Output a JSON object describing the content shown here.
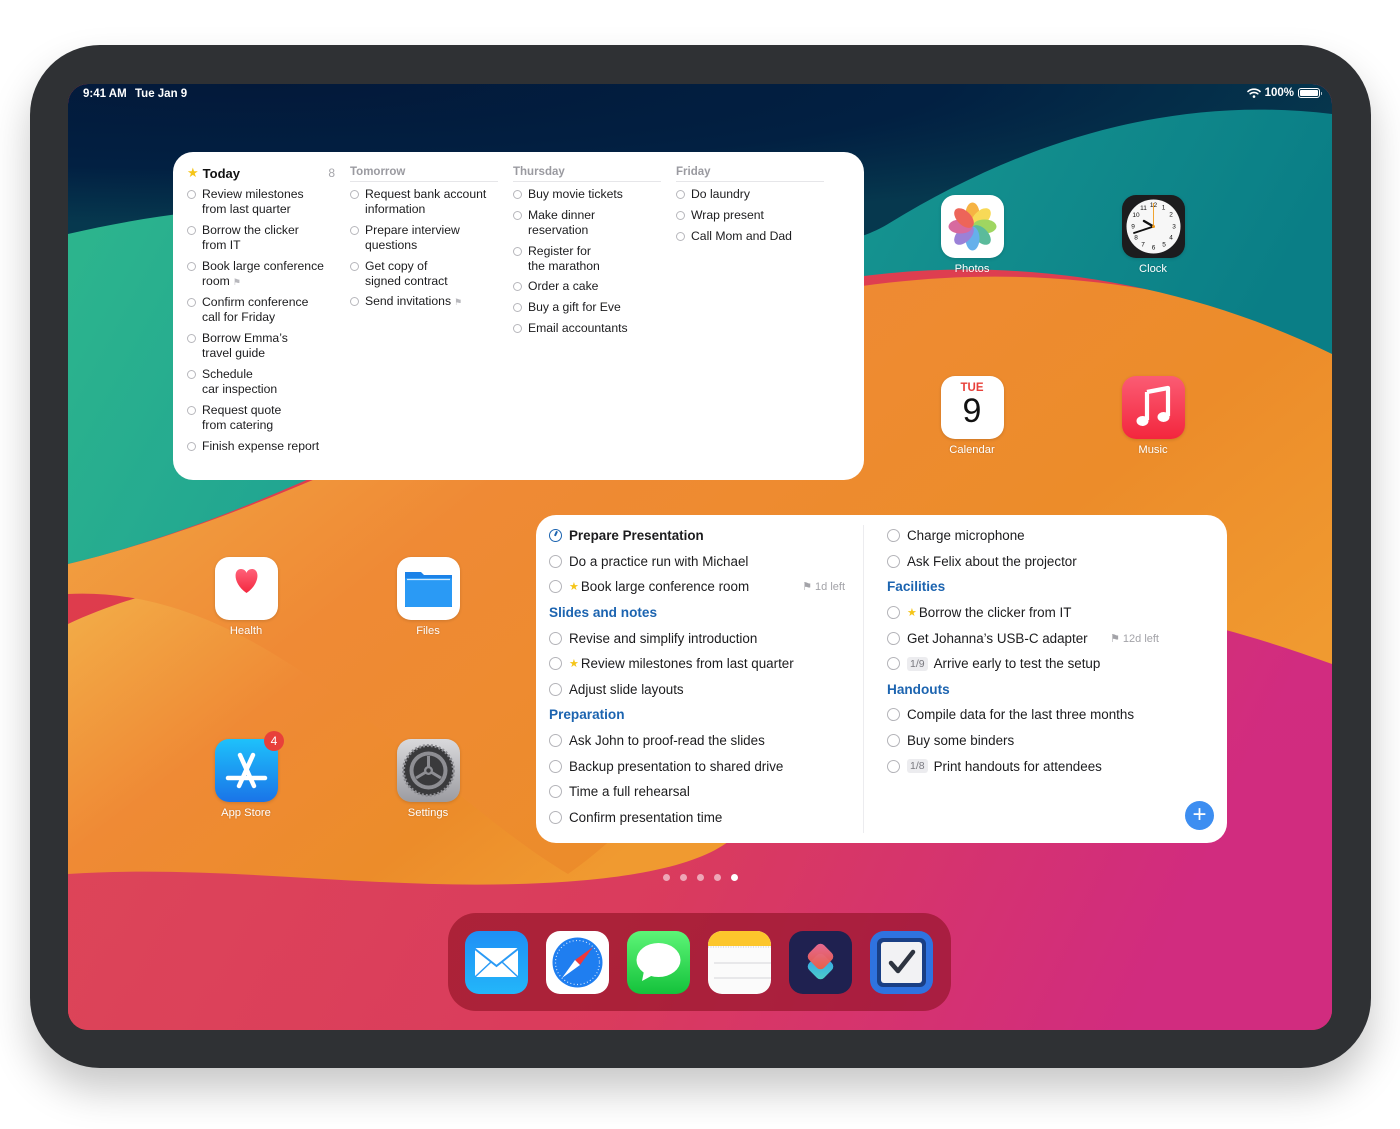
{
  "status_bar": {
    "time": "9:41 AM",
    "date": "Tue Jan 9",
    "battery_label": "100%",
    "battery_level": 1.0,
    "wifi_icon": "wifi-icon"
  },
  "week_widget": {
    "columns": [
      {
        "title": "Today",
        "count": "8",
        "icon": "star-icon",
        "items": [
          {
            "text": "Review milestones from last quarter",
            "lines": [
              "Review milestones",
              "from last quarter"
            ]
          },
          {
            "text": "Borrow the clicker from IT",
            "lines": [
              "Borrow the clicker",
              "from IT"
            ]
          },
          {
            "text": "Book large conference room",
            "lines": [
              "Book large conference",
              "room"
            ],
            "flag": true
          },
          {
            "text": "Confirm conference call for Friday",
            "lines": [
              "Confirm conference",
              "call for Friday"
            ]
          },
          {
            "text": "Borrow Emma’s travel guide",
            "lines": [
              "Borrow Emma’s",
              "travel guide"
            ]
          },
          {
            "text": "Schedule car inspection",
            "lines": [
              "Schedule",
              "car inspection"
            ]
          },
          {
            "text": "Request quote from catering",
            "lines": [
              "Request quote",
              "from catering"
            ]
          },
          {
            "text": "Finish expense report",
            "lines": [
              "Finish expense report"
            ]
          }
        ]
      },
      {
        "title": "Tomorrow",
        "items": [
          {
            "text": "Request bank account information",
            "lines": [
              "Request bank account",
              "information"
            ]
          },
          {
            "text": "Prepare interview questions",
            "lines": [
              "Prepare interview",
              "questions"
            ]
          },
          {
            "text": "Get copy of signed contract",
            "lines": [
              "Get copy of",
              "signed contract"
            ]
          },
          {
            "text": "Send invitations",
            "lines": [
              "Send invitations"
            ],
            "flag": true
          }
        ]
      },
      {
        "title": "Thursday",
        "items": [
          {
            "text": "Buy movie tickets",
            "lines": [
              "Buy movie tickets"
            ]
          },
          {
            "text": "Make dinner reservation",
            "lines": [
              "Make dinner",
              "reservation"
            ]
          },
          {
            "text": "Register for the marathon",
            "lines": [
              "Register for",
              "the marathon"
            ]
          },
          {
            "text": "Order a cake",
            "lines": [
              "Order a cake"
            ]
          },
          {
            "text": "Buy a gift for Eve",
            "lines": [
              "Buy a gift for Eve"
            ]
          },
          {
            "text": "Email accountants",
            "lines": [
              "Email accountants"
            ]
          }
        ]
      },
      {
        "title": "Friday",
        "items": [
          {
            "text": "Do laundry",
            "lines": [
              "Do laundry"
            ]
          },
          {
            "text": "Wrap present",
            "lines": [
              "Wrap present"
            ]
          },
          {
            "text": "Call Mom and Dad",
            "lines": [
              "Call Mom and Dad"
            ]
          }
        ]
      }
    ]
  },
  "project_widget": {
    "title": "Prepare Presentation",
    "left": [
      {
        "type": "task",
        "text": "Do a practice run with Michael"
      },
      {
        "type": "task",
        "text": "Book large conference room",
        "star": true,
        "due": "1d left"
      },
      {
        "type": "section",
        "text": "Slides and notes"
      },
      {
        "type": "task",
        "text": "Revise and simplify introduction"
      },
      {
        "type": "task",
        "text": "Review milestones from last quarter",
        "star": true
      },
      {
        "type": "task",
        "text": "Adjust slide layouts"
      },
      {
        "type": "section",
        "text": "Preparation"
      },
      {
        "type": "task",
        "text": "Ask John to proof-read the slides"
      },
      {
        "type": "task",
        "text": "Backup presentation to shared drive"
      },
      {
        "type": "task",
        "text": "Time a full rehearsal"
      },
      {
        "type": "task",
        "text": "Confirm presentation time"
      }
    ],
    "right": [
      {
        "type": "task",
        "text": "Charge microphone"
      },
      {
        "type": "task",
        "text": "Ask Felix about the projector"
      },
      {
        "type": "section",
        "text": "Facilities"
      },
      {
        "type": "task",
        "text": "Borrow the clicker from IT",
        "star": true
      },
      {
        "type": "task",
        "text": "Get Johanna’s USB-C adapter",
        "due": "12d left"
      },
      {
        "type": "task",
        "text": "Arrive early to test the setup",
        "checklist": "1/9"
      },
      {
        "type": "section",
        "text": "Handouts"
      },
      {
        "type": "task",
        "text": "Compile data for the last three months"
      },
      {
        "type": "task",
        "text": "Buy some binders"
      },
      {
        "type": "task",
        "text": "Print handouts for attendees",
        "checklist": "1/8"
      }
    ],
    "add_button_label": "+"
  },
  "apps": {
    "photos": "Photos",
    "clock": "Clock",
    "calendar": "Calendar",
    "calendar_day": "TUE",
    "calendar_date": "9",
    "music": "Music",
    "health": "Health",
    "files": "Files",
    "app_store": "App Store",
    "app_store_badge": "4",
    "settings": "Settings"
  },
  "page_indicator": {
    "total": 5,
    "current": 5
  },
  "dock": [
    "Mail",
    "Safari",
    "Messages",
    "Notes",
    "Shortcuts",
    "Things"
  ],
  "colors": {
    "accent_blue": "#1c64b0",
    "add_button": "#3d8ef1",
    "star": "#f5c518",
    "badge": "#e8403a"
  }
}
